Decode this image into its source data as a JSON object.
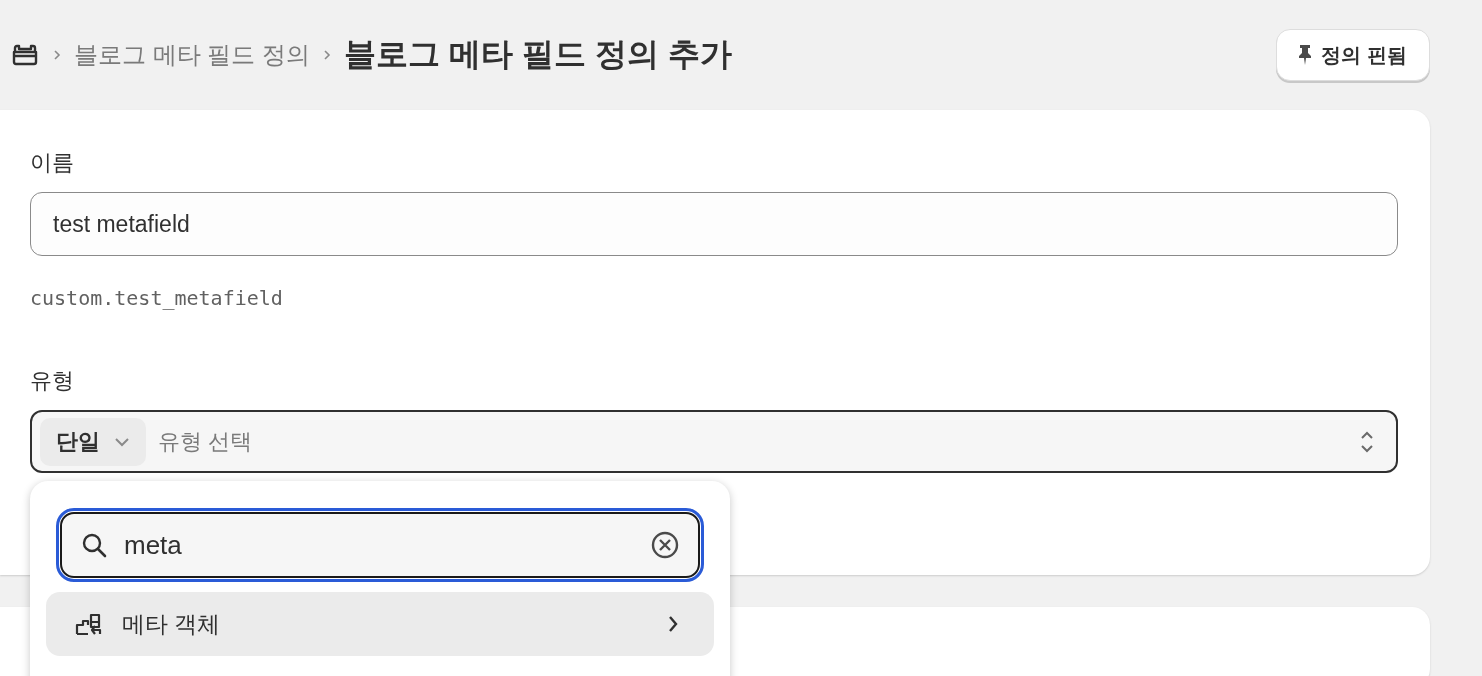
{
  "breadcrumb": {
    "parent": "블로그 메타 필드 정의",
    "title": "블로그 메타 필드 정의 추가"
  },
  "pin_button": {
    "label": "정의 핀됨"
  },
  "name_field": {
    "label": "이름",
    "value": "test metafield",
    "namespace_key": "custom.test_metafield"
  },
  "type_field": {
    "label": "유형",
    "cardinality": "단일",
    "placeholder": "유형 선택",
    "expanded": true
  },
  "type_popover": {
    "search": {
      "value": "meta"
    },
    "items": [
      {
        "label": "메타 객체",
        "selected": true
      }
    ]
  }
}
